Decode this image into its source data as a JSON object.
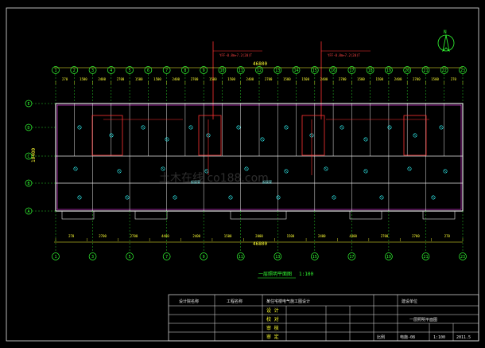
{
  "drawing": {
    "overall_dim": "46800",
    "bottom_overall_dim": "46800",
    "depth_dim": "10400",
    "riser_labels": [
      "YFF-0.8m+7.2(20)T",
      "YFF-0.8m+7.2(20)T"
    ],
    "north_label": "N",
    "caption": "一层照明平面图",
    "scale": "1:100",
    "room_labels": [
      "起居室",
      "起居室"
    ]
  },
  "axes": {
    "top": [
      "1",
      "2",
      "3",
      "4",
      "5",
      "6",
      "7",
      "8",
      "9",
      "10",
      "11",
      "12",
      "13",
      "14",
      "15",
      "16",
      "17",
      "18",
      "19",
      "20",
      "21",
      "22",
      "23"
    ],
    "bottom": [
      "1",
      "3",
      "5",
      "7",
      "9",
      "11",
      "13",
      "15",
      "17",
      "19",
      "21",
      "23"
    ],
    "left": [
      "A",
      "B",
      "C",
      "D",
      "E"
    ]
  },
  "dims": {
    "top": [
      "270",
      "1500",
      "2400",
      "2700",
      "1500",
      "1500",
      "2400",
      "2700",
      "1500",
      "1500",
      "2400",
      "2700",
      "1500",
      "1500",
      "2400",
      "2700",
      "1500",
      "1500",
      "2400",
      "2700",
      "1500",
      "270"
    ],
    "bottom": [
      "270",
      "2700",
      "2700",
      "4400",
      "2400",
      "1500",
      "2000",
      "1500",
      "2400",
      "4400",
      "2700",
      "2700",
      "270"
    ]
  },
  "title_block": {
    "company": "设计院名称",
    "project_label": "工程名称",
    "project": "某住宅楼电气施工图设计",
    "client": "建设单位",
    "drawing_name": "一层照明平面图",
    "roles": [
      "设 计",
      "校 对",
      "审 核",
      "审 定"
    ],
    "sheet": "电施-08",
    "scale_label": "比例",
    "scale": "1:100",
    "date": "2011.5"
  },
  "watermark": "土木在线 co188.com",
  "colors": {
    "axis": "#33ff33",
    "wall": "#e6e6e6",
    "window": "#ff44ff",
    "wire": "#ff3333",
    "fixture": "#33ffff",
    "dim": "#ffff33"
  }
}
